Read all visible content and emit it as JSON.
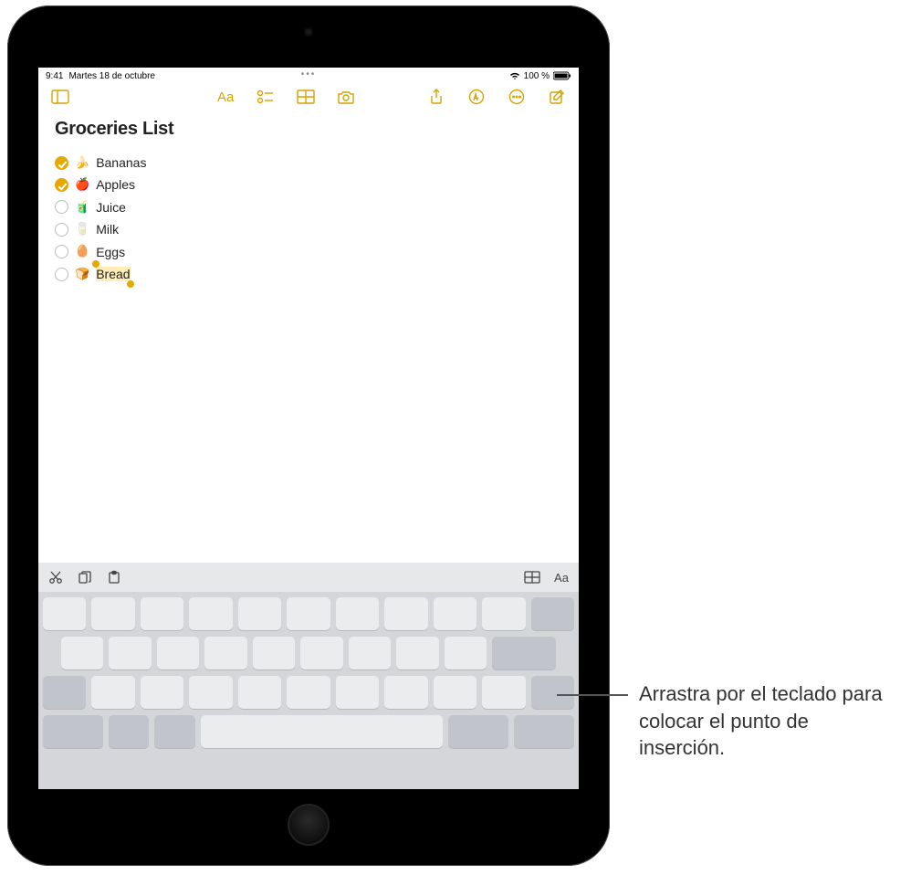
{
  "status": {
    "time": "9:41",
    "date": "Martes 18 de octubre",
    "battery_text": "100 %"
  },
  "note": {
    "title": "Groceries List",
    "items": [
      {
        "checked": true,
        "emoji": "🍌",
        "label": "Bananas"
      },
      {
        "checked": true,
        "emoji": "🍎",
        "label": "Apples"
      },
      {
        "checked": false,
        "emoji": "🧃",
        "label": "Juice"
      },
      {
        "checked": false,
        "emoji": "🥛",
        "label": "Milk"
      },
      {
        "checked": false,
        "emoji": "🥚",
        "label": "Eggs"
      },
      {
        "checked": false,
        "emoji": "🍞",
        "label": "Bread"
      }
    ]
  },
  "toolbar_icons": {
    "sidebar": "sidebar",
    "format": "Aa",
    "checklist": "checklist",
    "table": "table",
    "camera": "camera",
    "share": "share",
    "markup": "markup",
    "more": "more",
    "compose": "compose"
  },
  "kb_toolbar_icons": {
    "cut": "scissors",
    "copy": "docs",
    "paste": "clipboard",
    "table": "table",
    "format": "Aa"
  },
  "annotation": {
    "text": "Arrastra por el teclado para colocar el punto de inserción."
  },
  "colors": {
    "accent": "#e7a800"
  }
}
